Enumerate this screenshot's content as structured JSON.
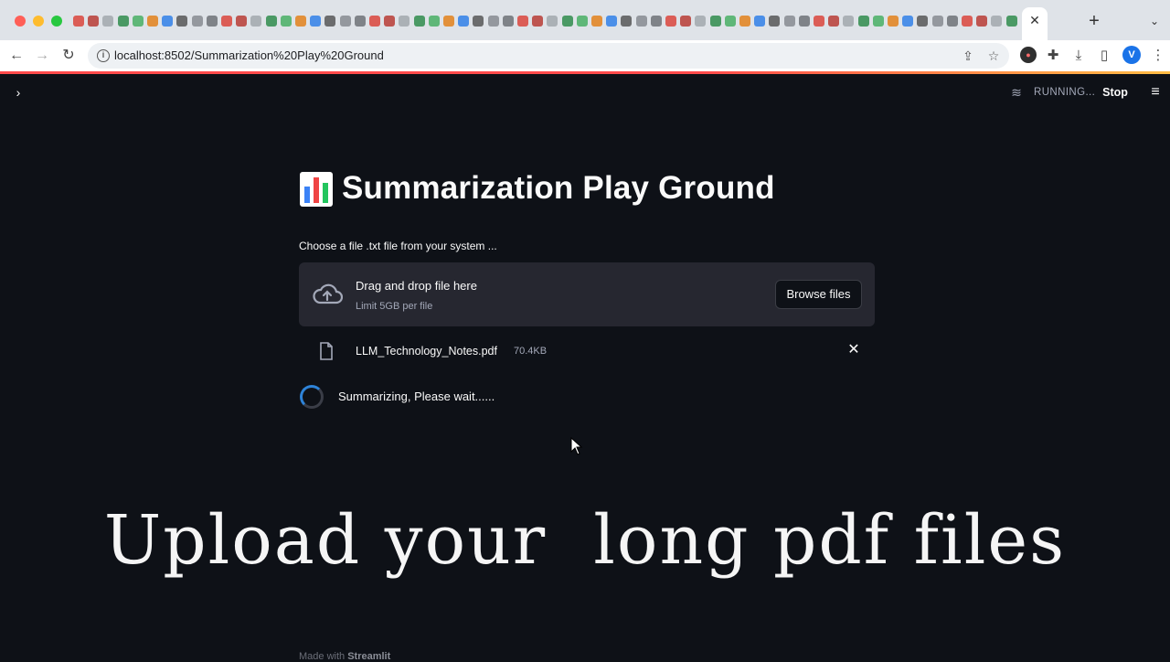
{
  "browser": {
    "url": "localhost:8502/Summarization%20Play%20Ground",
    "active_tab_close": "✕",
    "new_tab": "+",
    "profile_initial": "V"
  },
  "app": {
    "status_text": "RUNNING...",
    "stop_label": "Stop",
    "title": "Summarization Play Ground",
    "uploader": {
      "label": "Choose a file .txt file from your system ...",
      "dropzone_title": "Drag and drop file here",
      "dropzone_limit": "Limit 5GB per file",
      "browse_label": "Browse files"
    },
    "uploaded_file": {
      "name": "LLM_Technology_Notes.pdf",
      "size": "70.4KB"
    },
    "spinner_text": "Summarizing, Please wait......",
    "footer_prefix": "Made with",
    "footer_brand": "Streamlit"
  },
  "overlay": {
    "caption": "Upload your  long pdf files"
  },
  "colors": {
    "background": "#0e1117",
    "panel": "#262730",
    "accent": "#ff4b4b",
    "spinner": "#2e83d8"
  }
}
